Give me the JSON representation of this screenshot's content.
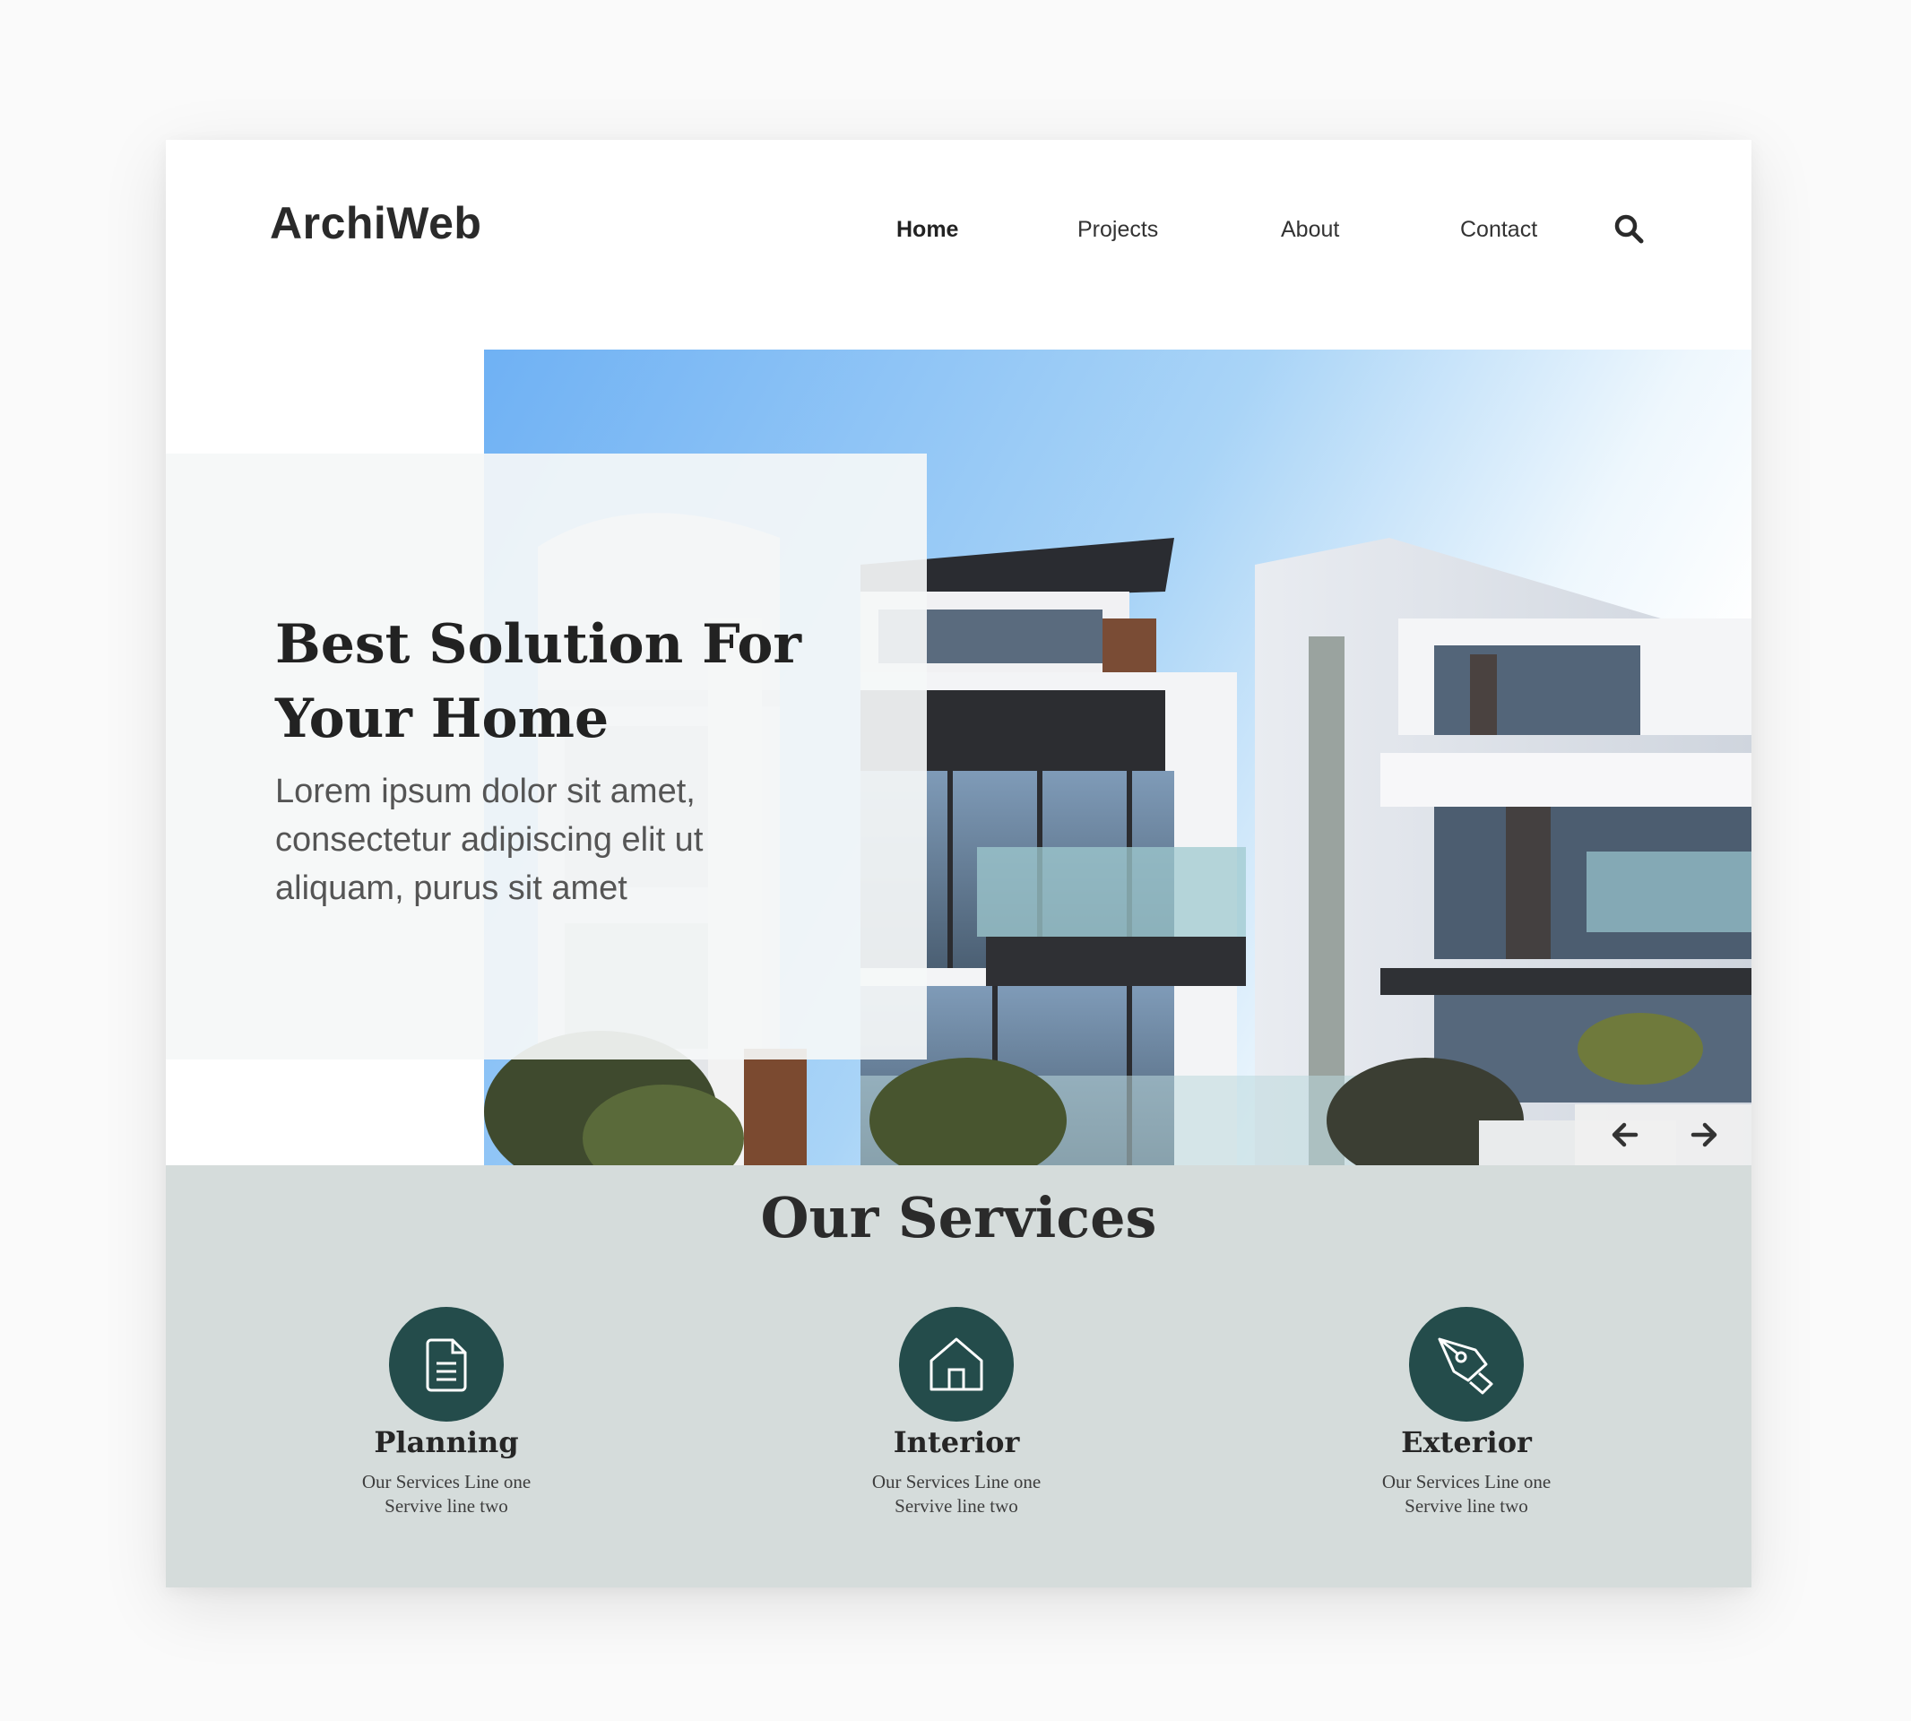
{
  "header": {
    "logo": "ArchiWeb",
    "nav": [
      {
        "label": "Home",
        "active": true
      },
      {
        "label": "Projects",
        "active": false
      },
      {
        "label": "About",
        "active": false
      },
      {
        "label": "Contact",
        "active": false
      }
    ],
    "search_icon": "search-icon"
  },
  "hero": {
    "title_line1": "Best Solution For",
    "title_line2": "Your Home",
    "text_line1": "Lorem ipsum dolor sit amet,",
    "text_line2": "consectetur adipiscing elit ut",
    "text_line3": "aliquam, purus sit amet",
    "prev_icon": "arrow-left-icon",
    "next_icon": "arrow-right-icon"
  },
  "services": {
    "title": "Our Services",
    "items": [
      {
        "name": "Planning",
        "line1": "Our Services Line one",
        "line2": "Servive line two",
        "icon": "document-icon"
      },
      {
        "name": "Interior",
        "line1": "Our Services Line one",
        "line2": "Servive line two",
        "icon": "house-icon"
      },
      {
        "name": "Exterior",
        "line1": "Our Services Line one",
        "line2": "Servive line two",
        "icon": "pen-nib-icon"
      }
    ]
  },
  "colors": {
    "accent": "#244c4b",
    "services_bg": "#d5dcdb",
    "text_dark": "#222222"
  }
}
